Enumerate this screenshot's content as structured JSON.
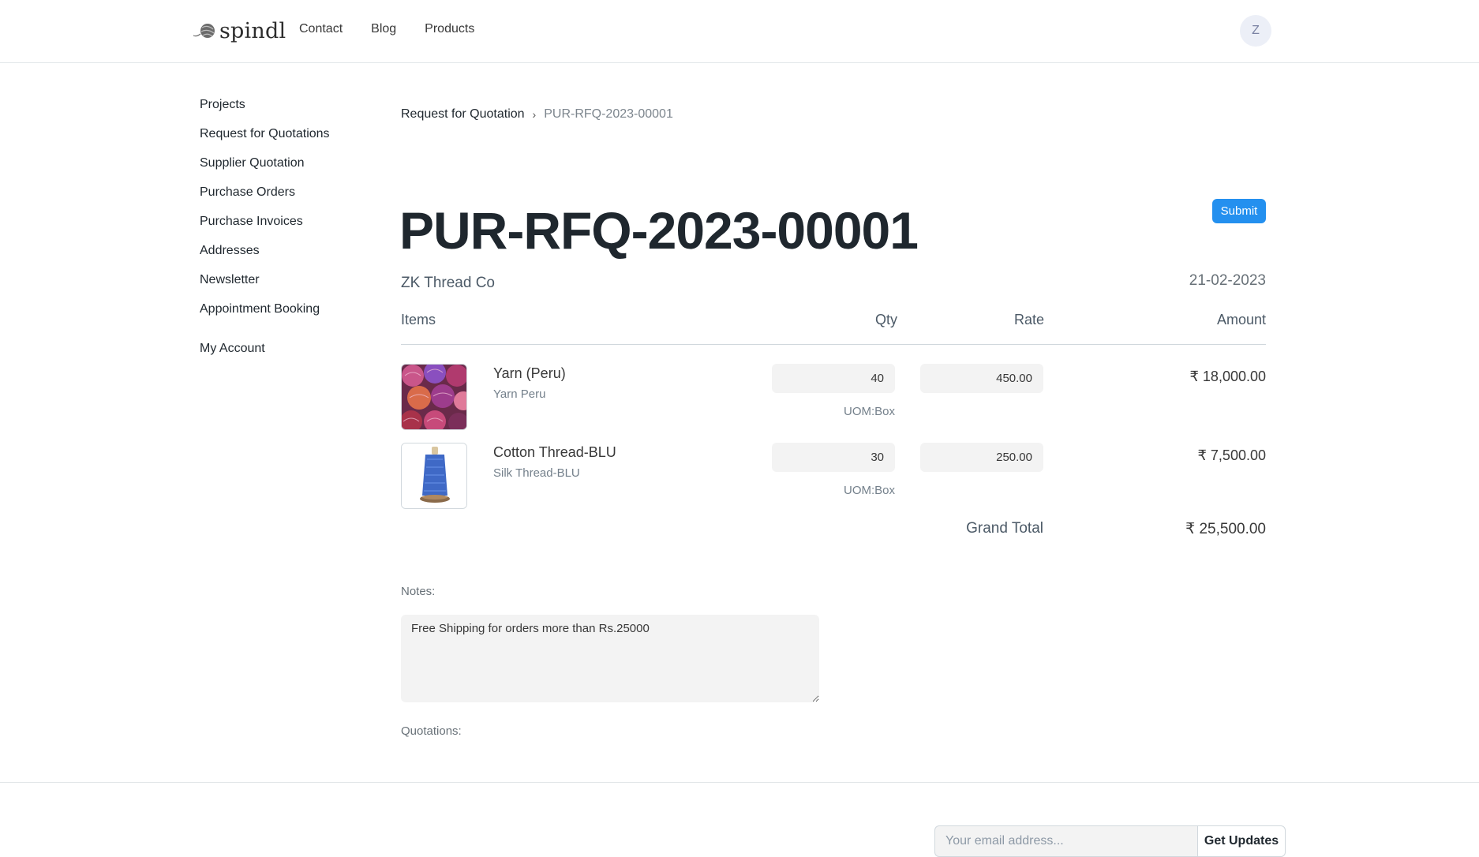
{
  "navbar": {
    "brand": "spindl",
    "links": [
      "Contact",
      "Blog",
      "Products"
    ],
    "avatar_initial": "Z"
  },
  "sidebar": {
    "items": [
      "Projects",
      "Request for Quotations",
      "Supplier Quotation",
      "Purchase Orders",
      "Purchase Invoices",
      "Addresses",
      "Newsletter",
      "Appointment Booking"
    ],
    "account": "My Account"
  },
  "breadcrumb": {
    "parent": "Request for Quotation",
    "current": "PUR-RFQ-2023-00001"
  },
  "doc": {
    "title": "PUR-RFQ-2023-00001",
    "submit_label": "Submit",
    "supplier": "ZK Thread Co",
    "date": "21-02-2023"
  },
  "table": {
    "headers": {
      "items": "Items",
      "qty": "Qty",
      "rate": "Rate",
      "amount": "Amount"
    },
    "rows": [
      {
        "name": "Yarn (Peru)",
        "code": "Yarn Peru",
        "qty": "40",
        "rate": "450.00",
        "uom": "UOM:Box",
        "amount": "₹ 18,000.00",
        "thumb_icon": "yarn-balls-image"
      },
      {
        "name": "Cotton Thread-BLU",
        "code": "Silk Thread-BLU",
        "qty": "30",
        "rate": "250.00",
        "uom": "UOM:Box",
        "amount": "₹ 7,500.00",
        "thumb_icon": "thread-spool-image"
      }
    ],
    "grand_total_label": "Grand Total",
    "grand_total_value": "₹ 25,500.00"
  },
  "notes": {
    "label": "Notes:",
    "value": "Free Shipping for orders more than Rs.25000"
  },
  "quotations": {
    "label": "Quotations:"
  },
  "footer": {
    "email_placeholder": "Your email address...",
    "subscribe_label": "Get Updates"
  },
  "colors": {
    "accent": "#2490ef",
    "text": "#1f272e",
    "muted": "#687178",
    "input_bg": "#f3f3f3",
    "border": "#d1d8dd"
  }
}
